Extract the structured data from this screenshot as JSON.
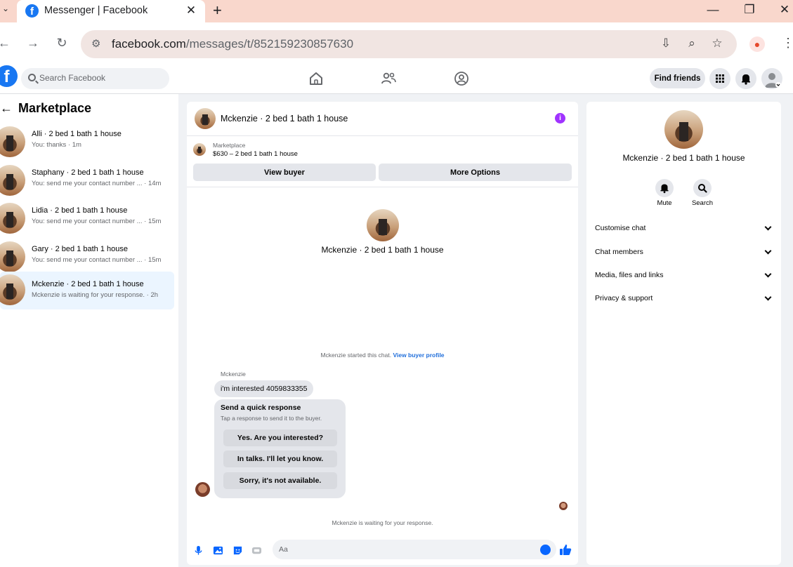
{
  "browser": {
    "tab_title": "Messenger | Facebook",
    "url_host": "facebook.com",
    "url_path": "/messages/t/852159230857630"
  },
  "header": {
    "search_placeholder": "Search Facebook",
    "find_friends": "Find friends"
  },
  "sidebar": {
    "title": "Marketplace",
    "conversations": [
      {
        "name": "Alli · 2 bed 1 bath 1 house",
        "preview": "You: thanks · 1m"
      },
      {
        "name": "Staphany · 2 bed 1 bath 1 house",
        "preview": "You: send me your contact number ... · 14m"
      },
      {
        "name": "Lidia · 2 bed 1 bath 1 house",
        "preview": "You: send me your contact number ... · 15m"
      },
      {
        "name": "Gary · 2 bed 1 bath 1 house",
        "preview": "You: send me your contact number ... · 15m"
      },
      {
        "name": "Mckenzie · 2 bed 1 bath 1 house",
        "preview": "Mckenzie is waiting for your response. · 2h"
      }
    ]
  },
  "chat": {
    "title": "Mckenzie · 2 bed 1 bath 1 house",
    "marketplace_label": "Marketplace",
    "listing": "$630 – 2 bed 1 bath 1 house",
    "view_buyer": "View buyer",
    "more_options": "More Options",
    "intro_name": "Mckenzie · 2 bed 1 bath 1 house",
    "started_text": "Mckenzie started this chat.",
    "view_buyer_profile": "View buyer profile",
    "sender": "Mckenzie",
    "message": "i'm interested 4059833355",
    "quick_title": "Send a quick response",
    "quick_sub": "Tap a response to send it to the buyer.",
    "quick_responses": [
      "Yes. Are you interested?",
      "In talks. I'll let you know.",
      "Sorry, it's not available."
    ],
    "waiting": "Mckenzie is waiting for your response.",
    "composer_placeholder": "Aa"
  },
  "info": {
    "name": "Mckenzie · 2 bed 1 bath 1 house",
    "mute": "Mute",
    "search": "Search",
    "sections": [
      "Customise chat",
      "Chat members",
      "Media, files and links",
      "Privacy & support"
    ]
  },
  "colors": {
    "brand_blue": "#1877f2",
    "info_purple": "#a033ff",
    "active_row": "#ebf5ff"
  }
}
